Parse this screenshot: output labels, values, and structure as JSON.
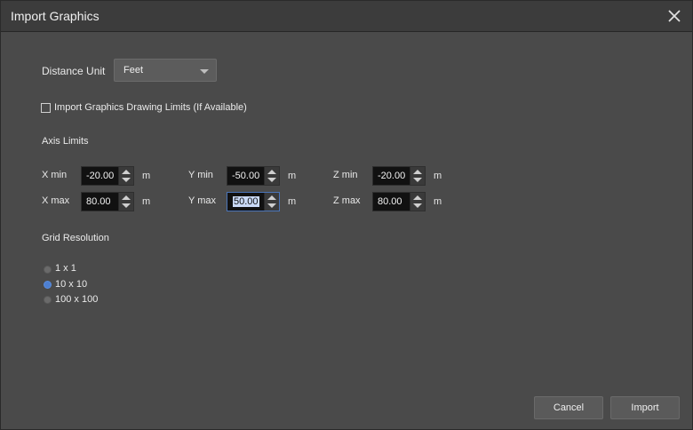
{
  "window": {
    "title": "Import Graphics"
  },
  "distance_unit": {
    "label": "Distance Unit",
    "value": "Feet"
  },
  "import_limits": {
    "label": "Import Graphics Drawing Limits (If Available)",
    "checked": false
  },
  "axis_limits": {
    "heading": "Axis Limits",
    "x_min": {
      "label": "X min",
      "value": "-20.00",
      "unit": "m"
    },
    "x_max": {
      "label": "X max",
      "value": "80.00",
      "unit": "m"
    },
    "y_min": {
      "label": "Y min",
      "value": "-50.00",
      "unit": "m"
    },
    "y_max": {
      "label": "Y max",
      "value": "50.00",
      "unit": "m"
    },
    "z_min": {
      "label": "Z min",
      "value": "-20.00",
      "unit": "m"
    },
    "z_max": {
      "label": "Z max",
      "value": "80.00",
      "unit": "m"
    }
  },
  "grid_resolution": {
    "heading": "Grid Resolution",
    "options": [
      {
        "label": "1 x 1",
        "selected": false
      },
      {
        "label": "10 x 10",
        "selected": true
      },
      {
        "label": "100 x 100",
        "selected": false
      }
    ]
  },
  "buttons": {
    "cancel": "Cancel",
    "import": "Import"
  },
  "colors": {
    "background": "#4a4a4a",
    "titlebar": "#3c3c3c",
    "accent": "#4d7fd1",
    "field": "#111111"
  }
}
